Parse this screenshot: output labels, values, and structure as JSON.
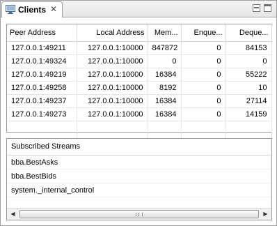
{
  "view": {
    "tab_title": "Clients",
    "tab_icon": "monitor-icon",
    "close_icon": "close-x-icon"
  },
  "clients_table": {
    "columns": [
      "Peer Address",
      "Local Address",
      "Mem...",
      "Enque...",
      "Deque..."
    ],
    "rows": [
      [
        "127.0.0.1:49211",
        "127.0.0.1:10000",
        "847872",
        "0",
        "84153"
      ],
      [
        "127.0.0.1:49324",
        "127.0.0.1:10000",
        "0",
        "0",
        "0"
      ],
      [
        "127.0.0.1:49219",
        "127.0.0.1:10000",
        "16384",
        "0",
        "55222"
      ],
      [
        "127.0.0.1:49258",
        "127.0.0.1:10000",
        "8192",
        "0",
        "10"
      ],
      [
        "127.0.0.1:49237",
        "127.0.0.1:10000",
        "16384",
        "0",
        "27114"
      ],
      [
        "127.0.0.1:49273",
        "127.0.0.1:10000",
        "16384",
        "0",
        "14159"
      ]
    ]
  },
  "streams": {
    "header": "Subscribed Streams",
    "items": [
      "bba.BestAsks",
      "bba.BestBids",
      "system._internal_control"
    ]
  }
}
